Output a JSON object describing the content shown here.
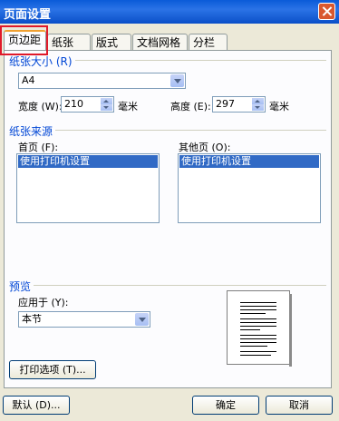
{
  "window": {
    "title": "页面设置"
  },
  "tabs": [
    {
      "label": "页边距",
      "active": true
    },
    {
      "label": "纸张",
      "active": false
    },
    {
      "label": "版式",
      "active": false
    },
    {
      "label": "文档网格",
      "active": false
    },
    {
      "label": "分栏",
      "active": false
    }
  ],
  "paper_size": {
    "group_label": "纸张大小 (R)",
    "selected": "A4",
    "width_label": "宽度 (W):",
    "width_value": "210",
    "width_unit": "毫米",
    "height_label": "高度 (E):",
    "height_value": "297",
    "height_unit": "毫米"
  },
  "paper_source": {
    "group_label": "纸张来源",
    "first_page_label": "首页 (F):",
    "first_page_item": "使用打印机设置",
    "other_pages_label": "其他页 (O):",
    "other_pages_item": "使用打印机设置"
  },
  "preview": {
    "group_label": "预览",
    "apply_to_label": "应用于 (Y):",
    "apply_to_value": "本节"
  },
  "buttons": {
    "print_options": "打印选项 (T)...",
    "default": "默认 (D)...",
    "ok": "确定",
    "cancel": "取消"
  },
  "colors": {
    "titlebar": "#0a5bd8",
    "group_label": "#0046d5",
    "selection": "#316ac5",
    "highlight_box": "#e0192a"
  }
}
